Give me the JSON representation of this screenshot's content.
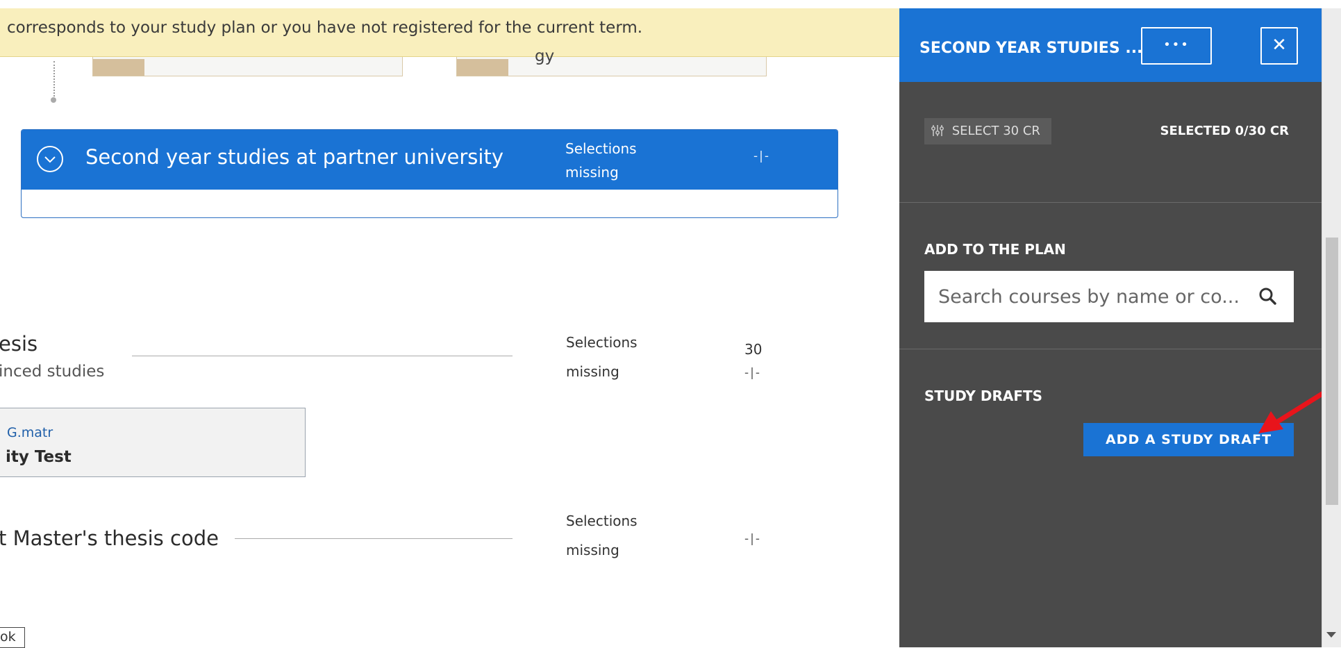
{
  "banner": {
    "text": "corresponds to your study plan or you have not registered for the current term."
  },
  "top_cards": {
    "right_text": "gy"
  },
  "group": {
    "title": "Second year studies at partner university",
    "status_line1": "Selections",
    "status_line2": "missing",
    "credits": "-|-"
  },
  "thesis_row": {
    "title": "esis",
    "subtitle": "inced studies",
    "status_line1": "Selections",
    "status_line2": "missing",
    "credits_top": "30",
    "credits_bottom": "-|-"
  },
  "course_card": {
    "code": "G.matr",
    "name": "ity Test"
  },
  "code_row": {
    "title": "t Master's thesis code",
    "status_line1": "Selections",
    "status_line2": "missing",
    "credits": "-|-"
  },
  "bottom_button": {
    "label": "ok"
  },
  "panel": {
    "title": "SECOND YEAR STUDIES ...",
    "more_label": "•••",
    "close_label": "✕",
    "select_cr": "SELECT 30 CR",
    "selected_cr": "SELECTED 0/30 CR",
    "add_to_plan_label": "ADD TO THE PLAN",
    "search_placeholder": "Search courses by name or co...",
    "study_drafts_label": "STUDY DRAFTS",
    "add_draft_label": "ADD A STUDY DRAFT"
  },
  "colors": {
    "accent_blue": "#1a73d4",
    "panel_dark": "#4a4a4a",
    "banner_yellow": "#f9efbd",
    "annotation_red": "#e8141b"
  },
  "icons": [
    "chevron-down-icon",
    "sliders-icon",
    "more-icon",
    "close-icon",
    "search-icon",
    "red-arrow-annotation",
    "scroll-down-arrow-icon"
  ]
}
